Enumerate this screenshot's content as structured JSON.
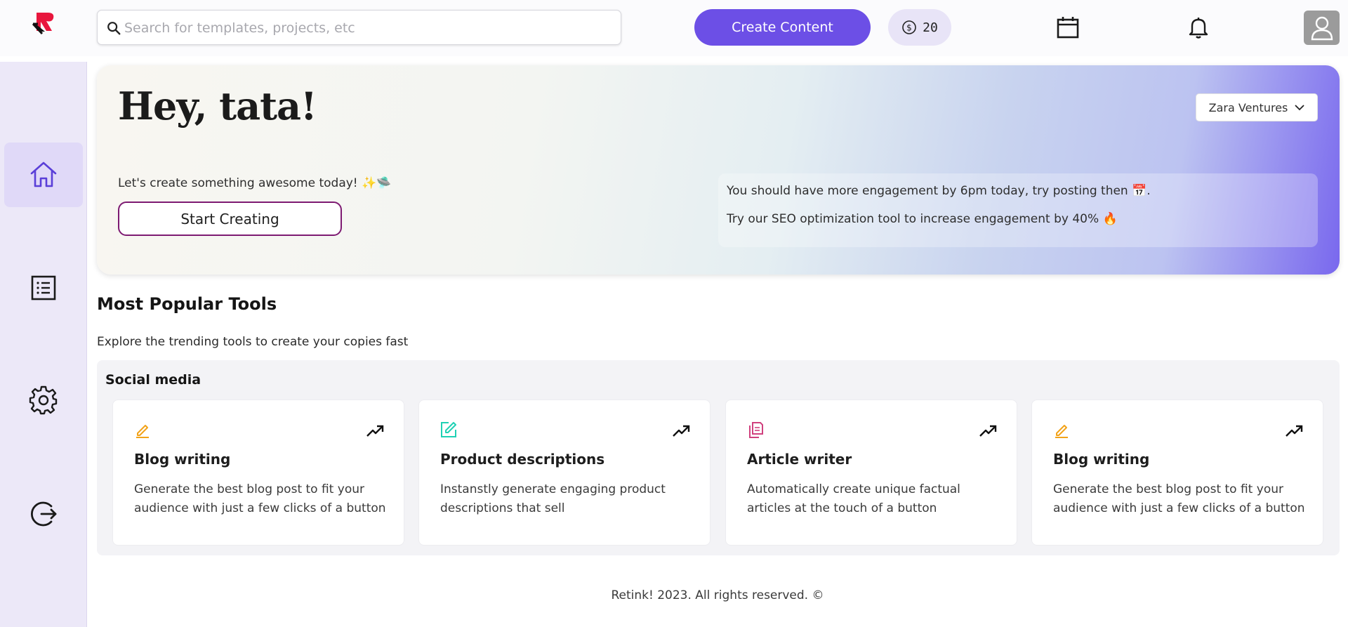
{
  "header": {
    "search_placeholder": "Search for templates, projects, etc",
    "create_label": "Create Content",
    "credits": "20"
  },
  "hero": {
    "greeting": "Hey, tata!",
    "subtitle": "Let's create something awesome today! ✨🛸",
    "start_label": "Start Creating",
    "company": "Zara Ventures",
    "tip1": "You should have more engagement by 6pm today, try posting then 📅.",
    "tip2": "Try our SEO optimization tool to increase engagement by 40% 🔥"
  },
  "tools": {
    "title": "Most Popular Tools",
    "subtitle": "Explore the trending tools to create your copies fast",
    "section": "Social media",
    "cards": [
      {
        "title": "Blog writing",
        "desc": "Generate the best blog post to fit your audience with just a few clicks of a button",
        "icon": "pencil-icon",
        "color": "#f2a31a"
      },
      {
        "title": "Product descriptions",
        "desc": "Instanstly generate engaging product descriptions that sell",
        "icon": "edit-square-icon",
        "color": "#1fd1b4"
      },
      {
        "title": "Article writer",
        "desc": "Automatically create unique factual articles at the touch of a button",
        "icon": "documents-icon",
        "color": "#d0417e"
      },
      {
        "title": "Blog writing",
        "desc": "Generate the best blog post to fit your audience with just a few clicks of a button",
        "icon": "pencil-icon",
        "color": "#f2a31a"
      }
    ]
  },
  "footer": "Retink! 2023. All rights reserved. ©",
  "colors": {
    "accent": "#6c4fe6",
    "sidebar": "#ece8f8",
    "start_border": "#7d1a72"
  }
}
